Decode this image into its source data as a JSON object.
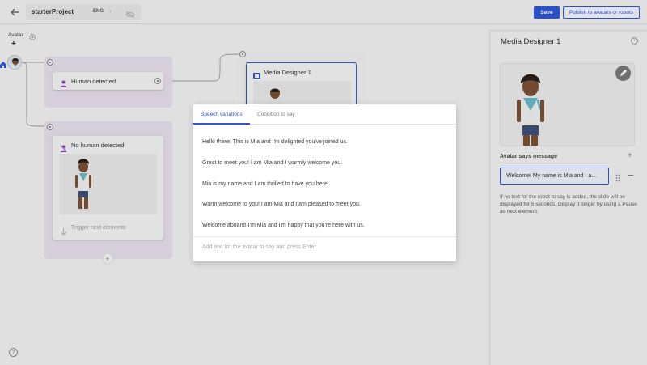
{
  "topbar": {
    "project_name": "starterProject",
    "language": "ENG",
    "save_label": "Save",
    "publish_label": "Publish to avatars or robots"
  },
  "canvas": {
    "avatar_label": "Avatar",
    "human_detected": "Human detected",
    "media_designer": "Media Designer 1",
    "no_human_detected": "No human detected",
    "trigger_next": "Trigger next elements"
  },
  "right_panel": {
    "title": "Media Designer 1",
    "avatar_says": "Avatar says message",
    "message_value": "Welcome! My name is Mia and I a...",
    "info": "If no text for the robot to say is added, the slide will be displayed for 5 seconds. Display it longer by using a Pause as next element."
  },
  "modal": {
    "tabs": [
      "Speech variations",
      "Condition to say"
    ],
    "active_tab": "Speech variations",
    "variations": [
      "Hello there! This is Mia and I'm delighted you've joined us.",
      "Great to meet you! I am Mia and I warmly welcome you.",
      "Mia is my name and I am thrilled to have you here.",
      "Warm welcome to you! I am Mia and I am pleased to meet you.",
      "Welcome aboard! I'm Mia and I'm happy that you're here with us."
    ],
    "add_placeholder": "Add text for the avatar to say and press Enter"
  },
  "colors": {
    "accent": "#2f55d4",
    "branch": "#e4dbe8",
    "human_icon": "#8a4bb5"
  },
  "icons": [
    "back-arrow-icon",
    "chevron-right-icon",
    "eye-off-icon",
    "gear-icon",
    "home-icon",
    "person-icon",
    "person-off-icon",
    "media-icon",
    "arrow-down-icon",
    "pencil-icon",
    "help-icon",
    "plus-icon",
    "drag-handle-icon",
    "minus-icon"
  ]
}
